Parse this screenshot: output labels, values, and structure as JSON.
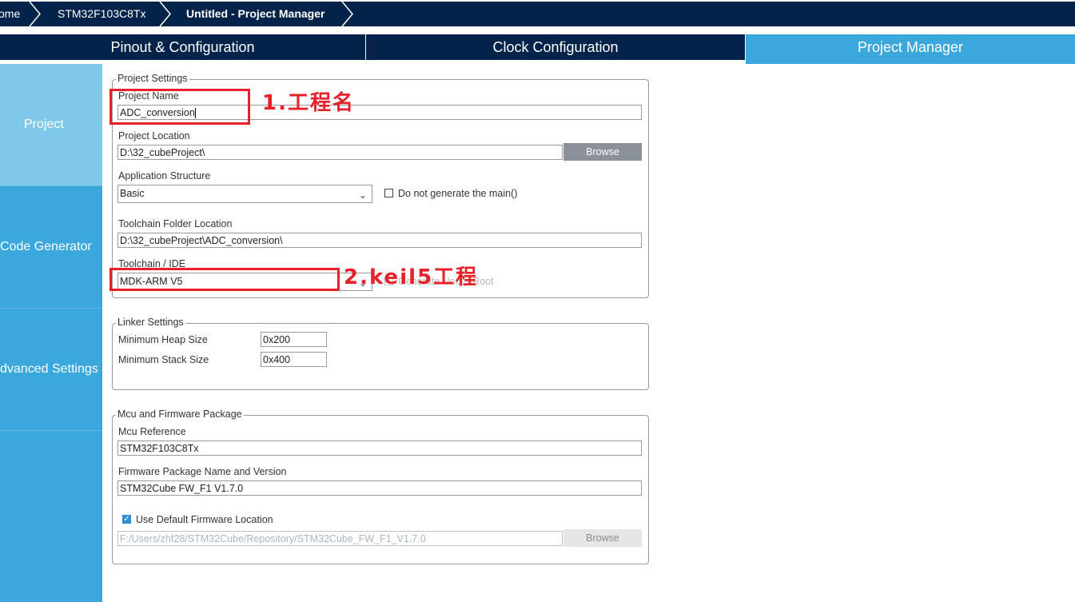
{
  "breadcrumb": {
    "home": "ome",
    "mcu": "STM32F103C8Tx",
    "current": "Untitled - Project Manager"
  },
  "tabs": {
    "pinout": "Pinout & Configuration",
    "clock": "Clock Configuration",
    "project_manager": "Project Manager"
  },
  "sidebar": {
    "project": "Project",
    "code_generator": "Code Generator",
    "advanced_settings": "dvanced Settings"
  },
  "project_settings": {
    "title": "Project Settings",
    "project_name_label": "Project Name",
    "project_name_value": "ADC_conversion",
    "location_label": "Project Location",
    "location_value": "D:\\32_cubeProject\\",
    "browse_label": "Browse",
    "app_structure_label": "Application Structure",
    "app_structure_value": "Basic",
    "no_main_label": "Do not generate the main()",
    "toolchain_folder_label": "Toolchain Folder Location",
    "toolchain_folder_value": "D:\\32_cubeProject\\ADC_conversion\\",
    "toolchain_ide_label": "Toolchain / IDE",
    "toolchain_ide_value": "MDK-ARM V5",
    "generate_under_root_label": "Generate Under Root"
  },
  "linker_settings": {
    "title": "Linker Settings",
    "heap_label": "Minimum Heap Size",
    "heap_value": "0x200",
    "stack_label": "Minimum Stack Size",
    "stack_value": "0x400"
  },
  "firmware": {
    "title": "Mcu and Firmware Package",
    "mcu_ref_label": "Mcu Reference",
    "mcu_ref_value": "STM32F103C8Tx",
    "fw_name_label": "Firmware Package Name and Version",
    "fw_name_value": "STM32Cube FW_F1 V1.7.0",
    "use_default_label": "Use Default Firmware Location",
    "fw_location_value": "F:/Users/zhf28/STM32Cube/Repository/STM32Cube_FW_F1_V1.7.0",
    "browse_label": "Browse"
  },
  "annotations": {
    "note1": "1.工程名",
    "note2": "2.keil5工程"
  },
  "colors": {
    "navy": "#03234b",
    "accent": "#3aa8dc",
    "annotation_red": "#e8202a"
  }
}
